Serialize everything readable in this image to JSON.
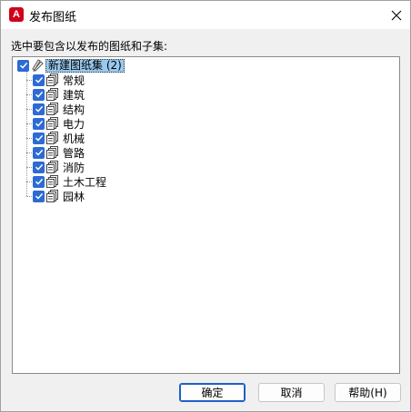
{
  "window": {
    "title": "发布图纸",
    "app_icon_letter": "A",
    "accent_color": "#d0021b"
  },
  "prompt": "选中要包含以发布的图纸和子集:",
  "tree": {
    "root": {
      "label": "新建图纸集 (2)",
      "checked": true
    },
    "items": [
      {
        "label": "常规",
        "checked": true
      },
      {
        "label": "建筑",
        "checked": true
      },
      {
        "label": "结构",
        "checked": true
      },
      {
        "label": "电力",
        "checked": true
      },
      {
        "label": "机械",
        "checked": true
      },
      {
        "label": "管路",
        "checked": true
      },
      {
        "label": "消防",
        "checked": true
      },
      {
        "label": "土木工程",
        "checked": true
      },
      {
        "label": "园林",
        "checked": true
      }
    ]
  },
  "buttons": {
    "ok": "确定",
    "cancel": "取消",
    "help": "帮助(H)"
  },
  "colors": {
    "checkbox": "#2d6ad5",
    "selection": "#99c9ef"
  }
}
